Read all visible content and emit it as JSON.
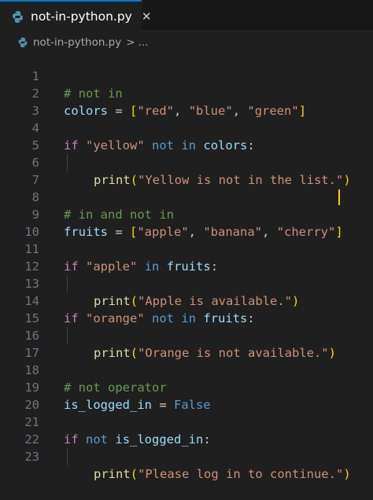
{
  "tab": {
    "label": "not-in-python.py",
    "close": "✕"
  },
  "breadcrumb": {
    "file": "not-in-python.py",
    "separator": ">",
    "more": "..."
  },
  "line_numbers": [
    "1",
    "2",
    "3",
    "4",
    "5",
    "6",
    "7",
    "8",
    "9",
    "10",
    "11",
    "12",
    "13",
    "14",
    "15",
    "16",
    "17",
    "18",
    "19",
    "20",
    "21",
    "22",
    "23"
  ],
  "code": {
    "l1": {
      "comment": "# not in"
    },
    "l2": {
      "var": "colors",
      "eq": " = ",
      "lb": "[",
      "s1": "\"red\"",
      "c1": ", ",
      "s2": "\"blue\"",
      "c2": ", ",
      "s3": "\"green\"",
      "rb": "]"
    },
    "l4": {
      "kw": "if",
      "sp": " ",
      "str": "\"yellow\"",
      "sp2": " ",
      "op": "not in",
      "sp3": " ",
      "var": "colors",
      "colon": ":"
    },
    "l5": {
      "fn": "print",
      "lp": "(",
      "str": "\"Yellow is not in the list.\"",
      "rp": ")"
    },
    "l8": {
      "comment": "# in and not in"
    },
    "l9": {
      "var": "fruits",
      "eq": " = ",
      "lb": "[",
      "s1": "\"apple\"",
      "c1": ", ",
      "s2": "\"banana\"",
      "c2": ", ",
      "s3": "\"cherry\"",
      "rb": "]"
    },
    "l11": {
      "kw": "if",
      "sp": " ",
      "str": "\"apple\"",
      "sp2": " ",
      "op": "in",
      "sp3": " ",
      "var": "fruits",
      "colon": ":"
    },
    "l12": {
      "fn": "print",
      "lp": "(",
      "str": "\"Apple is available.\"",
      "rp": ")"
    },
    "l14": {
      "kw": "if",
      "sp": " ",
      "str": "\"orange\"",
      "sp2": " ",
      "op": "not in",
      "sp3": " ",
      "var": "fruits",
      "colon": ":"
    },
    "l15": {
      "fn": "print",
      "lp": "(",
      "str": "\"Orange is not available.\"",
      "rp": ")"
    },
    "l18": {
      "comment": "# not operator"
    },
    "l19": {
      "var": "is_logged_in",
      "eq": " = ",
      "val": "False"
    },
    "l21": {
      "kw": "if",
      "sp": " ",
      "op": "not",
      "sp2": " ",
      "var": "is_logged_in",
      "colon": ":"
    },
    "l22": {
      "fn": "print",
      "lp": "(",
      "str": "\"Please log in to continue.\"",
      "rp": ")"
    }
  },
  "colors": {
    "keyword": "#c586c0",
    "operator": "#569cd6",
    "variable": "#9cdcfe",
    "function": "#dcdcaa",
    "string": "#ce9178",
    "comment": "#6a9955",
    "accent": "#0078d4",
    "cursor": "#ffcc00"
  },
  "icons": {
    "file_type": "python-icon",
    "close": "close-icon"
  }
}
